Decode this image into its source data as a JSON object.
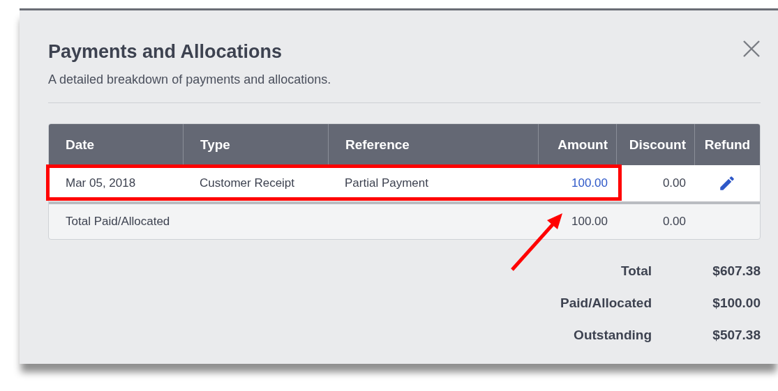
{
  "dialog": {
    "title": "Payments and Allocations",
    "subtitle": "A detailed breakdown of payments and allocations."
  },
  "table": {
    "columns": [
      {
        "label": "Date",
        "kind": "text"
      },
      {
        "label": "Type",
        "kind": "text"
      },
      {
        "label": "Reference",
        "kind": "text"
      },
      {
        "label": "Amount",
        "kind": "number"
      },
      {
        "label": "Discount",
        "kind": "number"
      },
      {
        "label": "Refund",
        "kind": "action"
      }
    ],
    "rows": [
      {
        "cells": [
          "Mar 05, 2018",
          "Customer Receipt",
          "Partial Payment",
          "100.00",
          "0.00"
        ],
        "amount_link": true,
        "highlighted": true,
        "editable": true
      }
    ],
    "total_row": {
      "label": "Total Paid/Allocated",
      "amount": "100.00",
      "discount": "0.00"
    }
  },
  "summary": [
    {
      "label": "Total",
      "value": "$607.38"
    },
    {
      "label": "Paid/Allocated",
      "value": "$100.00"
    },
    {
      "label": "Outstanding",
      "value": "$507.38"
    }
  ]
}
